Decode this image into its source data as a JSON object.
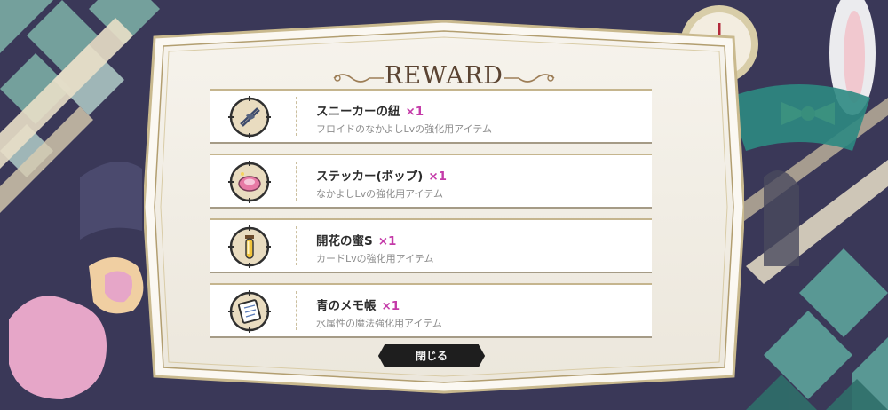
{
  "dialog": {
    "title": "REWARD",
    "close_label": "閉じる"
  },
  "rewards": [
    {
      "name": "スニーカーの紐",
      "qty": "×1",
      "desc": "フロイドのなかよしLvの強化用アイテム",
      "icon": "shoelace-icon"
    },
    {
      "name": "ステッカー(ポップ)",
      "qty": "×1",
      "desc": "なかよしLvの強化用アイテム",
      "icon": "sticker-icon"
    },
    {
      "name": "開花の蜜S",
      "qty": "×1",
      "desc": "カードLvの強化用アイテム",
      "icon": "honey-vial-icon"
    },
    {
      "name": "青のメモ帳",
      "qty": "×1",
      "desc": "水属性の魔法強化用アイテム",
      "icon": "notepad-icon"
    }
  ],
  "colors": {
    "accent_qty": "#c43aa8",
    "frame_gold": "#c9b98e",
    "panel_bg": "#f4f1ea",
    "button_bg": "#1e1e1e"
  }
}
